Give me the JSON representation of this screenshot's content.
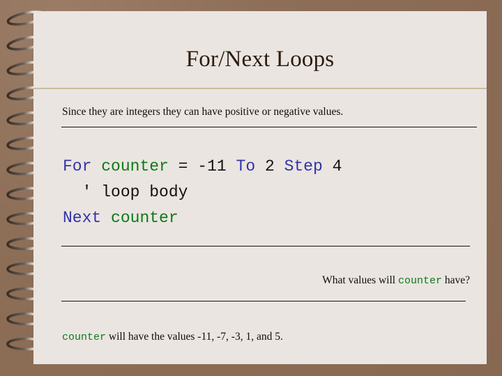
{
  "slide": {
    "title": "For/Next Loops",
    "background_color": "#8d6e57",
    "page_color": "#eae5e1",
    "title_color": "#2a1b10",
    "rule_color": "#c8be9e"
  },
  "body": {
    "intro": "Since they are integers they can have positive or negative values.",
    "question_prefix": "What values will ",
    "question_var": "counter",
    "question_suffix": " have?",
    "answer_var": "counter",
    "answer_text": " will have the values -11, -7, -3, 1, and 5."
  },
  "code": {
    "colors": {
      "keyword": "#3333a8",
      "variable": "#0d7a18",
      "literal": "#111111",
      "comment": "#111111"
    },
    "line1": {
      "kw_for": "For",
      "var_counter": "counter",
      "equals": "=",
      "start": "-11",
      "kw_to": "To",
      "end": "2",
      "kw_step": "Step",
      "step": "4"
    },
    "line2": {
      "comment": "' loop body"
    },
    "line3": {
      "kw_next": "Next",
      "var_counter": "counter"
    }
  },
  "binding": {
    "icon": "spiral-binding-icon",
    "ring_count": 14
  }
}
